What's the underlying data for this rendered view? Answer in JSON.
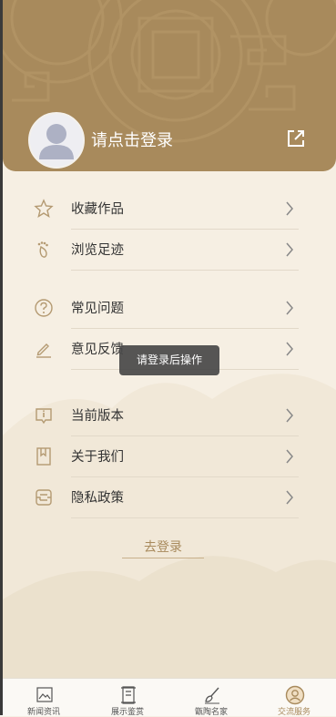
{
  "colors": {
    "brand": "#a88a5c",
    "background": "#f6efe3",
    "toast_bg": "#484848"
  },
  "profile": {
    "login_prompt": "请点击登录",
    "avatar_icon": "default-avatar-icon",
    "share_icon": "external-link-icon"
  },
  "menu": {
    "group1": [
      {
        "label": "收藏作品",
        "icon": "star-icon"
      },
      {
        "label": "浏览足迹",
        "icon": "footprint-icon"
      }
    ],
    "group2": [
      {
        "label": "常见问题",
        "icon": "question-icon"
      },
      {
        "label": "意见反馈",
        "icon": "pen-icon"
      }
    ],
    "group3": [
      {
        "label": "当前版本",
        "icon": "info-icon"
      },
      {
        "label": "关于我们",
        "icon": "bookmark-icon"
      },
      {
        "label": "隐私政策",
        "icon": "document-icon"
      }
    ]
  },
  "toast": {
    "text": "请登录后操作"
  },
  "goto_login": {
    "label": "去登录"
  },
  "tabbar": {
    "tabs": [
      {
        "label": "新闻资讯",
        "icon": "news-icon"
      },
      {
        "label": "展示鉴赏",
        "icon": "scroll-icon"
      },
      {
        "label": "甑陶名家",
        "icon": "brush-icon"
      },
      {
        "label": "交流服务",
        "icon": "user-circle-icon"
      }
    ],
    "active_index": 3
  }
}
